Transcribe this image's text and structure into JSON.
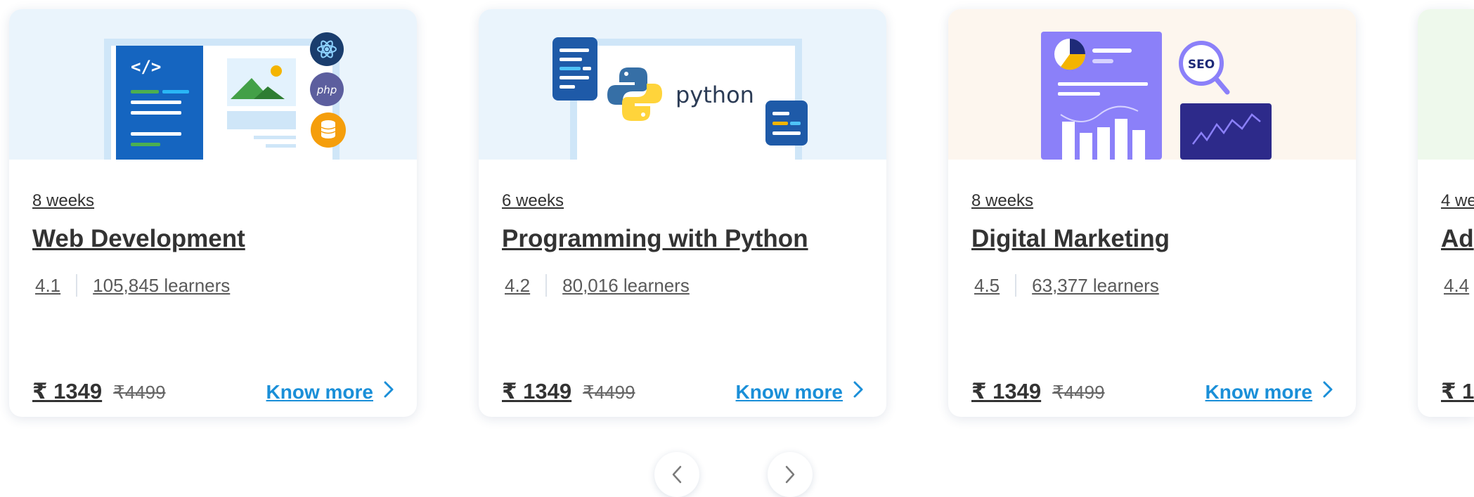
{
  "courses": [
    {
      "duration": "8 weeks",
      "title": "Web Development",
      "rating": "4.1",
      "learners": "105,845 learners",
      "price": "₹ 1349",
      "original_price": "₹4499",
      "cta": "Know more",
      "banner_color": "#eaf4fc"
    },
    {
      "duration": "6 weeks",
      "title": "Programming with Python",
      "rating": "4.2",
      "learners": "80,016 learners",
      "price": "₹ 1349",
      "original_price": "₹4499",
      "cta": "Know more",
      "banner_text": "python",
      "banner_color": "#eaf4fc"
    },
    {
      "duration": "8 weeks",
      "title": "Digital Marketing",
      "rating": "4.5",
      "learners": "63,377 learners",
      "price": "₹ 1349",
      "original_price": "₹4499",
      "cta": "Know more",
      "banner_text": "SEO",
      "banner_color": "#fdf6ee"
    },
    {
      "duration": "4 we",
      "title": "Ad",
      "rating": "4.4",
      "price": "₹ 1",
      "banner_color": "#eef9ec"
    }
  ],
  "icons": {
    "web_dev_languages": "php",
    "carousel_prev": "chevron-left-icon",
    "carousel_next": "chevron-right-icon"
  },
  "colors": {
    "accent": "#1a8fd8",
    "text": "#333333"
  }
}
